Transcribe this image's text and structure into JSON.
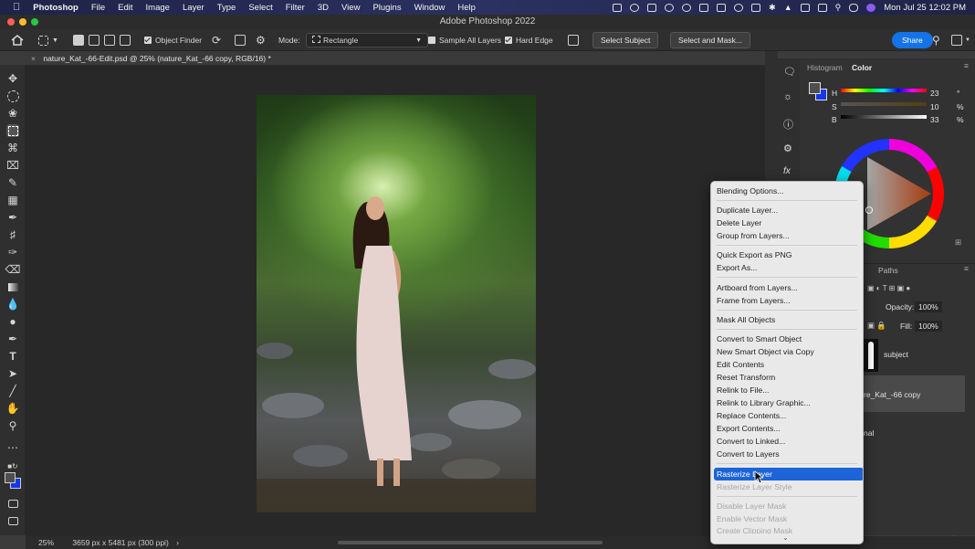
{
  "menubar": {
    "apple_icon": "apple-icon",
    "items": [
      "Photoshop",
      "File",
      "Edit",
      "Image",
      "Layer",
      "Type",
      "Select",
      "Filter",
      "3D",
      "View",
      "Plugins",
      "Window",
      "Help"
    ],
    "datetime": "Mon Jul 25  12:02 PM"
  },
  "window": {
    "title": "Adobe Photoshop 2022"
  },
  "options_bar": {
    "object_finder_label": "Object Finder",
    "mode_label": "Mode:",
    "mode_value": "Rectangle",
    "sample_all_layers_label": "Sample All Layers",
    "hard_edge_label": "Hard Edge",
    "select_subject_label": "Select Subject",
    "select_and_mask_label": "Select and Mask...",
    "share_label": "Share"
  },
  "document": {
    "tab_title": "nature_Kat_-66-Edit.psd @ 25% (nature_Kat_-66 copy, RGB/16) *",
    "zoom": "25%",
    "info": "3659 px x 5481 px (300 ppi)"
  },
  "color_panel": {
    "tabs": [
      "Histogram",
      "Color"
    ],
    "active_tab": "Color",
    "channels": [
      {
        "label": "H",
        "value": "23",
        "unit": "°"
      },
      {
        "label": "S",
        "value": "10",
        "unit": "%"
      },
      {
        "label": "B",
        "value": "33",
        "unit": "%"
      }
    ],
    "foreground_color": "#4e4e4e",
    "background_color": "#1438e6"
  },
  "layers_panel": {
    "tabs": [
      "s",
      "Paths"
    ],
    "opacity_label": "Opacity:",
    "opacity_value": "100%",
    "fill_label": "Fill:",
    "fill_value": "100%",
    "layers": [
      {
        "name": "subject"
      },
      {
        "name": "re_Kat_-66 copy"
      },
      {
        "name": "nal"
      }
    ]
  },
  "context_menu": {
    "items": [
      {
        "label": "Blending Options...",
        "state": "normal"
      },
      {
        "label": "Duplicate Layer...",
        "state": "normal"
      },
      {
        "label": "Delete Layer",
        "state": "normal"
      },
      {
        "label": "Group from Layers...",
        "state": "normal"
      },
      {
        "label": "Quick Export as PNG",
        "state": "normal"
      },
      {
        "label": "Export As...",
        "state": "normal"
      },
      {
        "label": "Artboard from Layers...",
        "state": "normal"
      },
      {
        "label": "Frame from Layers...",
        "state": "normal"
      },
      {
        "label": "Mask All Objects",
        "state": "normal"
      },
      {
        "label": "Convert to Smart Object",
        "state": "normal"
      },
      {
        "label": "New Smart Object via Copy",
        "state": "normal"
      },
      {
        "label": "Edit Contents",
        "state": "normal"
      },
      {
        "label": "Reset Transform",
        "state": "normal"
      },
      {
        "label": "Relink to File...",
        "state": "normal"
      },
      {
        "label": "Relink to Library Graphic...",
        "state": "normal"
      },
      {
        "label": "Replace Contents...",
        "state": "normal"
      },
      {
        "label": "Export Contents...",
        "state": "normal"
      },
      {
        "label": "Convert to Linked...",
        "state": "normal"
      },
      {
        "label": "Convert to Layers",
        "state": "normal"
      },
      {
        "label": "Rasterize Layer",
        "state": "selected"
      },
      {
        "label": "Rasterize Layer Style",
        "state": "disabled"
      },
      {
        "label": "Disable Layer Mask",
        "state": "disabled"
      },
      {
        "label": "Enable Vector Mask",
        "state": "disabled"
      },
      {
        "label": "Create Clipping Mask",
        "state": "disabled"
      }
    ]
  }
}
